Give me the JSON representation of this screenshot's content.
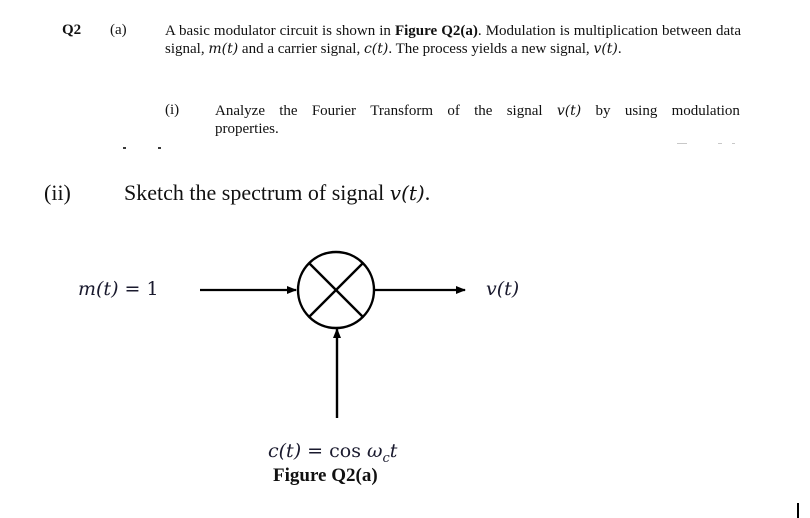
{
  "question": {
    "number": "Q2",
    "part_label": "(a)",
    "intro": {
      "seg1": "A basic modulator circuit is shown in ",
      "figure_ref": "Figure Q2(a)",
      "seg2": ". Modulation is multiplication between data signal, ",
      "m_sym": "m(t)",
      "seg3": " and a carrier signal, ",
      "c_sym": "c(t)",
      "seg4": ". The process yields a new signal, ",
      "v_sym": "v(t)",
      "seg5": "."
    },
    "sub_i": {
      "label": "(i)",
      "words": [
        "Analyze",
        "the",
        "Fourier",
        "Transform",
        "of",
        "the",
        "signal"
      ],
      "v_sym": "v(t)",
      "words_after": [
        "by",
        "using",
        "modulation"
      ],
      "line2": "properties."
    },
    "sub_ii": {
      "label": "(ii)",
      "text": "Sketch the spectrum of signal ",
      "v_sym": "v(t)",
      "end": "."
    }
  },
  "figure": {
    "input_label_sym": "m(t)",
    "input_label_eq": " = 1",
    "output_label": "v(t)",
    "carrier_label_sym": "c(t)",
    "carrier_label_eq": " = cos ",
    "carrier_omega": "ω",
    "carrier_sub": "c",
    "carrier_t": "t",
    "caption": "Figure Q2(a)",
    "multiplier_symbol": "multiplier-cross-circle"
  }
}
